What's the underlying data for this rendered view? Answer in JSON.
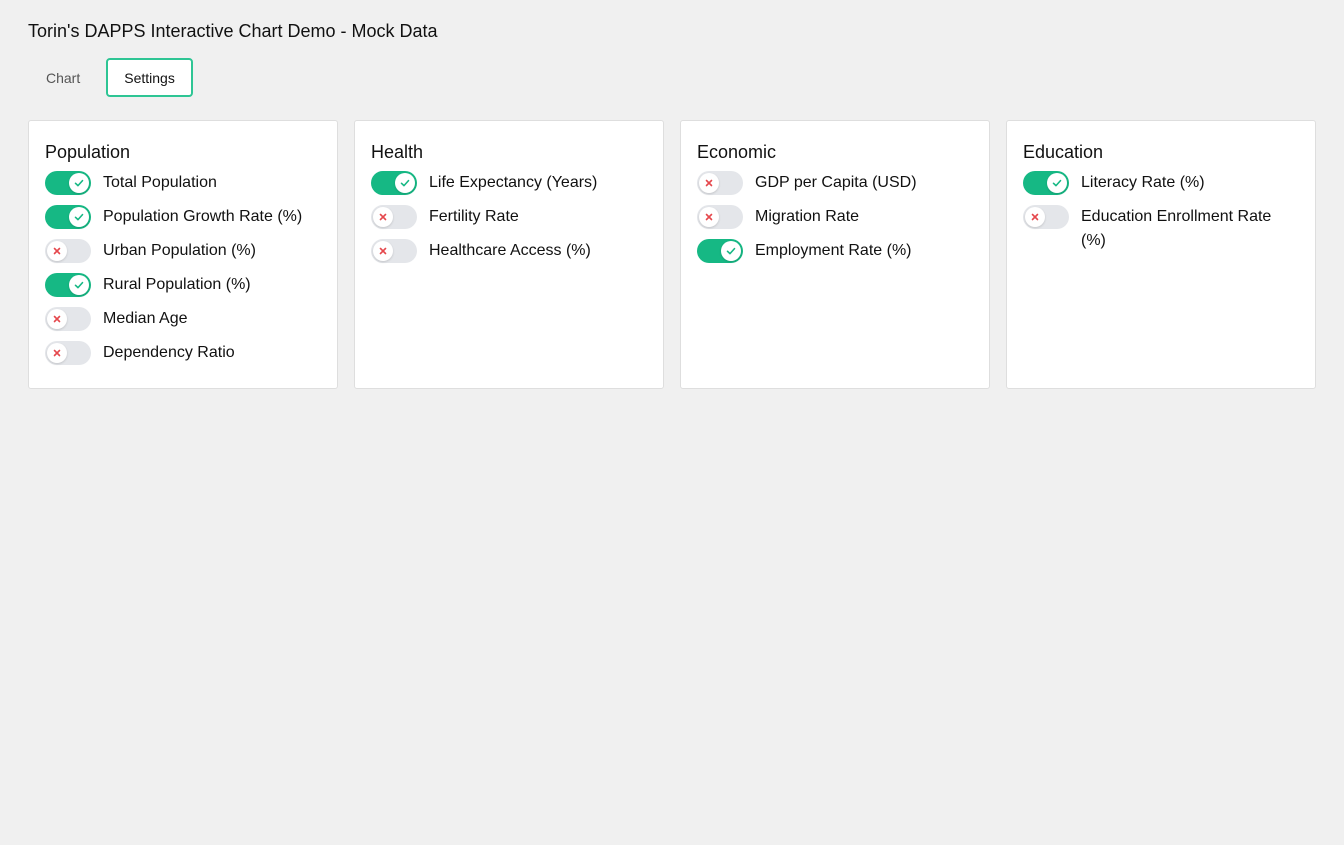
{
  "app": {
    "title": "Torin's DAPPS Interactive Chart Demo - Mock Data"
  },
  "tabs": [
    {
      "label": "Chart",
      "active": false
    },
    {
      "label": "Settings",
      "active": true
    }
  ],
  "colors": {
    "accent": "#16b884",
    "active_tab_border": "#2ec594",
    "off_icon": "#e5484d"
  },
  "settings": {
    "groups": [
      {
        "title": "Population",
        "options": [
          {
            "label": "Total Population",
            "enabled": true
          },
          {
            "label": "Population Growth Rate (%)",
            "enabled": true
          },
          {
            "label": "Urban Population (%)",
            "enabled": false
          },
          {
            "label": "Rural Population (%)",
            "enabled": true
          },
          {
            "label": "Median Age",
            "enabled": false
          },
          {
            "label": "Dependency Ratio",
            "enabled": false
          }
        ]
      },
      {
        "title": "Health",
        "options": [
          {
            "label": "Life Expectancy (Years)",
            "enabled": true
          },
          {
            "label": "Fertility Rate",
            "enabled": false
          },
          {
            "label": "Healthcare Access (%)",
            "enabled": false
          }
        ]
      },
      {
        "title": "Economic",
        "options": [
          {
            "label": "GDP per Capita (USD)",
            "enabled": false
          },
          {
            "label": "Migration Rate",
            "enabled": false
          },
          {
            "label": "Employment Rate (%)",
            "enabled": true
          }
        ]
      },
      {
        "title": "Education",
        "options": [
          {
            "label": "Literacy Rate (%)",
            "enabled": true
          },
          {
            "label": "Education Enrollment Rate (%)",
            "enabled": false
          }
        ]
      }
    ]
  }
}
